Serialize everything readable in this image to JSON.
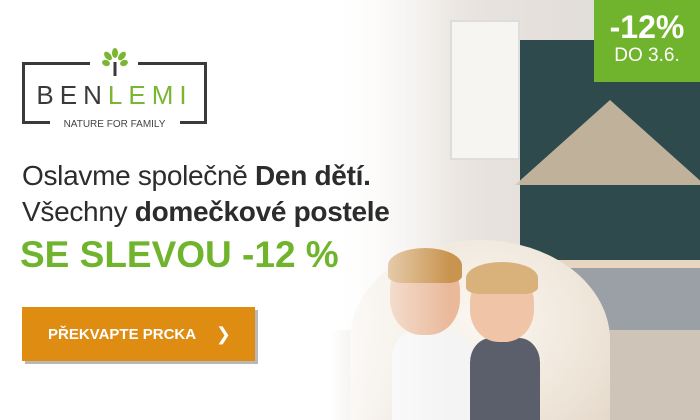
{
  "brand": {
    "name_dark": "BEN",
    "name_green": "LEMI",
    "tagline": "NATURE FOR FAMILY"
  },
  "badge": {
    "discount": "-12%",
    "until": "DO 3.6."
  },
  "headline": {
    "line1_regular": "Oslavme společně ",
    "line1_bold": "Den dětí.",
    "line2_regular": "Všechny ",
    "line2_bold": "domečkové postele"
  },
  "promo": "SE SLEVOU -12 %",
  "cta": {
    "label": "PŘEKVAPTE PRCKA",
    "icon": "chevron-right-icon"
  },
  "colors": {
    "green": "#6fb42c",
    "orange": "#de8c12",
    "text": "#2c2c2c"
  }
}
